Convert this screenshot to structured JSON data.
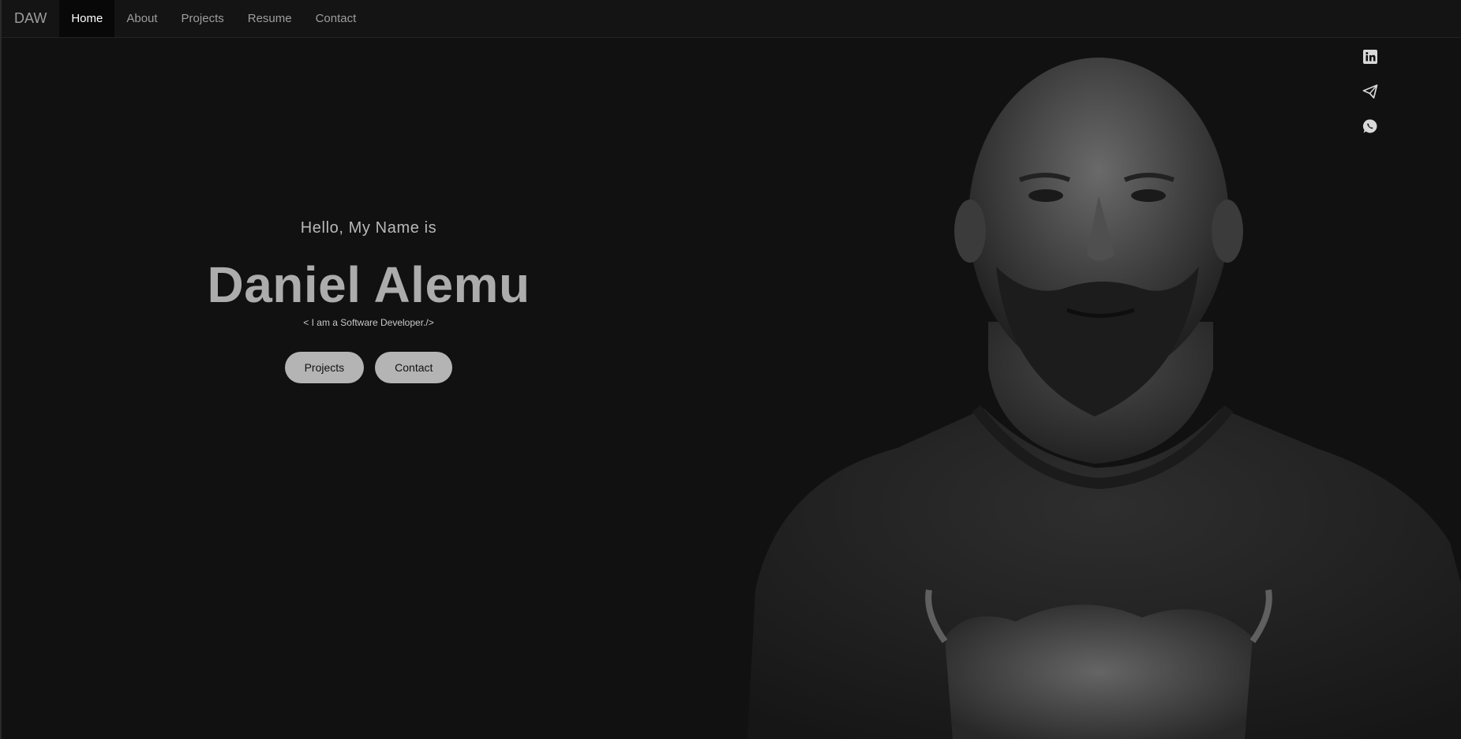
{
  "navbar": {
    "brand": "DAW",
    "items": [
      {
        "label": "Home",
        "active": true
      },
      {
        "label": "About",
        "active": false
      },
      {
        "label": "Projects",
        "active": false
      },
      {
        "label": "Resume",
        "active": false
      },
      {
        "label": "Contact",
        "active": false
      }
    ]
  },
  "hero": {
    "greeting": "Hello, My Name is",
    "name": "Daniel Alemu",
    "tagline": "< I am a Software Developer./>",
    "buttons": {
      "projects": "Projects",
      "contact": "Contact"
    }
  },
  "social": {
    "icons": [
      "linkedin-icon",
      "telegram-icon",
      "whatsapp-icon"
    ]
  },
  "theme": {
    "background": "#111112",
    "navbar_bg": "#141415",
    "active_tab_bg": "#080808",
    "button_bg": "#b4b4b4",
    "heading_color": "#acacac"
  }
}
